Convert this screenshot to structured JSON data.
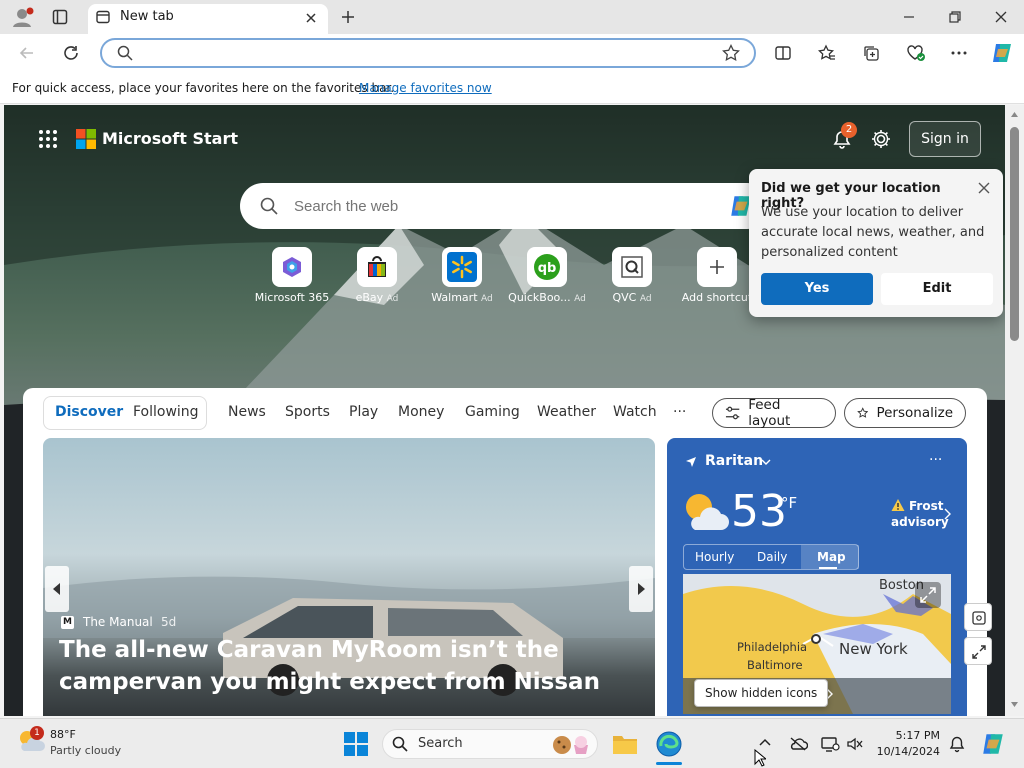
{
  "browser": {
    "tab_title": "New tab",
    "address_placeholder": "",
    "favorites_message": "For quick access, place your favorites here on the favorites bar.",
    "favorites_link": "Manage favorites now"
  },
  "page": {
    "brand": "Microsoft Start",
    "notification_count": "2",
    "sign_in": "Sign in",
    "search_placeholder": "Search the web",
    "shortcuts": [
      {
        "label": "Microsoft 365",
        "ad": ""
      },
      {
        "label": "eBay",
        "ad": "Ad"
      },
      {
        "label": "Walmart",
        "ad": "Ad"
      },
      {
        "label": "QuickBoo...",
        "ad": "Ad"
      },
      {
        "label": "QVC",
        "ad": "Ad"
      },
      {
        "label": "Add shortcut",
        "ad": ""
      }
    ],
    "location_popup": {
      "title": "Did we get your location right?",
      "body": "We use your location to deliver accurate local news, weather, and personalized content",
      "yes": "Yes",
      "edit": "Edit"
    },
    "feed_tabs": {
      "discover": "Discover",
      "following": "Following",
      "items": [
        "News",
        "Sports",
        "Play",
        "Money",
        "Gaming",
        "Weather",
        "Watch"
      ],
      "more": "···",
      "feed_layout": "Feed layout",
      "personalize": "Personalize"
    },
    "hero": {
      "source": "The Manual",
      "age": "5d",
      "headline": "The all-new Caravan MyRoom isn’t the campervan you might expect from Nissan"
    },
    "weather": {
      "location": "Raritan",
      "temp": "53",
      "unit": "°F",
      "alert_line1": "Frost",
      "alert_line2": "advisory",
      "tabs": [
        "Hourly",
        "Daily",
        "Map"
      ],
      "map_cities": [
        "Boston",
        "Philadelphia",
        "New York",
        "Baltimore"
      ],
      "tooltip": "Show hidden icons",
      "see_more_fragment": "s"
    }
  },
  "taskbar": {
    "weather_temp": "88°F",
    "weather_desc": "Partly cloudy",
    "weather_badge": "1",
    "search": "Search",
    "time": "5:17 PM",
    "date": "10/14/2024"
  },
  "colors": {
    "accent": "#0f6cbd",
    "yes_button": "#0f6cbd",
    "weather_card": "#2e64b6",
    "notification_badge": "#e8612c"
  }
}
